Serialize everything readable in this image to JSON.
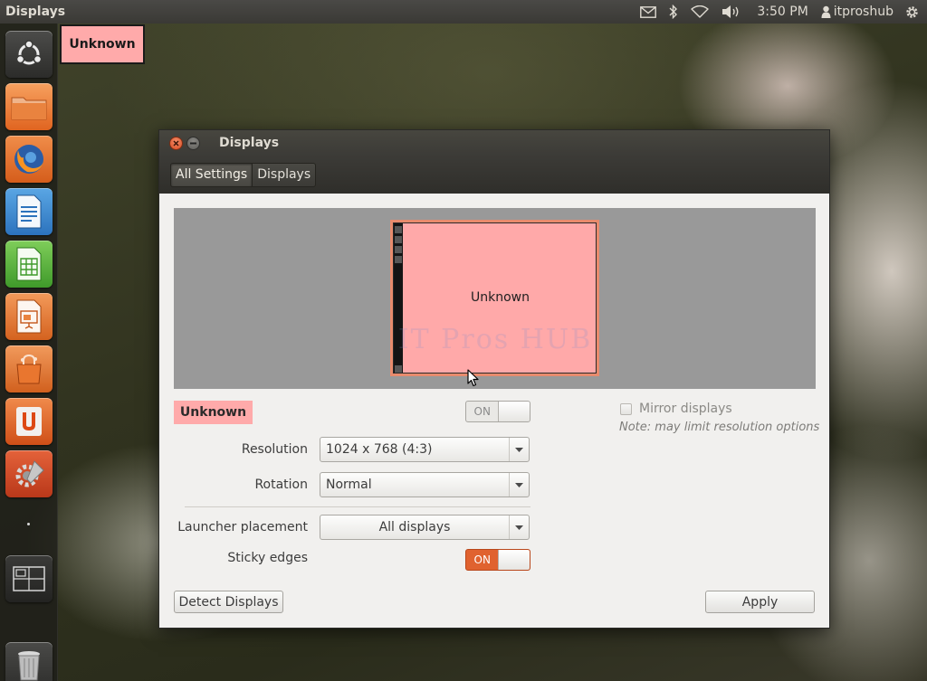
{
  "top_panel": {
    "app_title": "Displays",
    "clock": "3:50 PM",
    "user": "itproshub",
    "indicators": [
      "mail-icon",
      "bluetooth-icon",
      "wifi-icon",
      "volume-icon",
      "user-icon",
      "gear-icon"
    ]
  },
  "launcher": {
    "items": [
      "ubuntu-dash",
      "home-folder",
      "firefox",
      "libreoffice-writer",
      "libreoffice-calc",
      "libreoffice-impress",
      "ubuntu-software-center",
      "ubuntu-one",
      "system-settings",
      "workspace-switcher",
      "trash"
    ]
  },
  "desktop_label": "Unknown",
  "window": {
    "title": "Displays",
    "breadcrumbs": [
      "All Settings",
      "Displays"
    ],
    "monitor_preview": {
      "label": "Unknown",
      "watermark": "IT Pros HUB"
    },
    "display_name": "Unknown",
    "power_switch": {
      "label": "ON",
      "state": "on"
    },
    "mirror": {
      "label": "Mirror displays",
      "checked": false,
      "note": "Note: may limit resolution options"
    },
    "resolution": {
      "label": "Resolution",
      "value": "1024 x 768 (4:3)"
    },
    "rotation": {
      "label": "Rotation",
      "value": "Normal"
    },
    "launcher_placement": {
      "label": "Launcher placement",
      "value": "All displays"
    },
    "sticky_edges": {
      "label": "Sticky edges",
      "switch_label": "ON",
      "state": "on"
    },
    "buttons": {
      "detect": "Detect Displays",
      "apply": "Apply"
    }
  },
  "colors": {
    "accent": "#e0622f",
    "monitor_fill": "#ffa9a9",
    "monitor_border": "#e88b6d",
    "panel": "#3c3b37",
    "window_bg": "#f1f0ee"
  }
}
